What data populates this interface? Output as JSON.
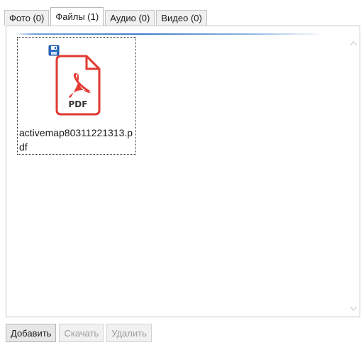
{
  "tabs": [
    {
      "label": "Фото (0)",
      "active": false
    },
    {
      "label": "Файлы (1)",
      "active": true
    },
    {
      "label": "Аудио (0)",
      "active": false
    },
    {
      "label": "Видео (0)",
      "active": false
    }
  ],
  "files": [
    {
      "name": "activemap80311221313.pdf",
      "icon": "pdf-file-icon",
      "badge_icon": "floppy-disk-icon",
      "icon_text": "PDF"
    }
  ],
  "buttons": {
    "add_label": "Добавить",
    "download_label": "Скачать",
    "delete_label": "Удалить"
  },
  "colors": {
    "pdf_red": "#e23a32",
    "accent_blue": "#3e7bc8"
  }
}
